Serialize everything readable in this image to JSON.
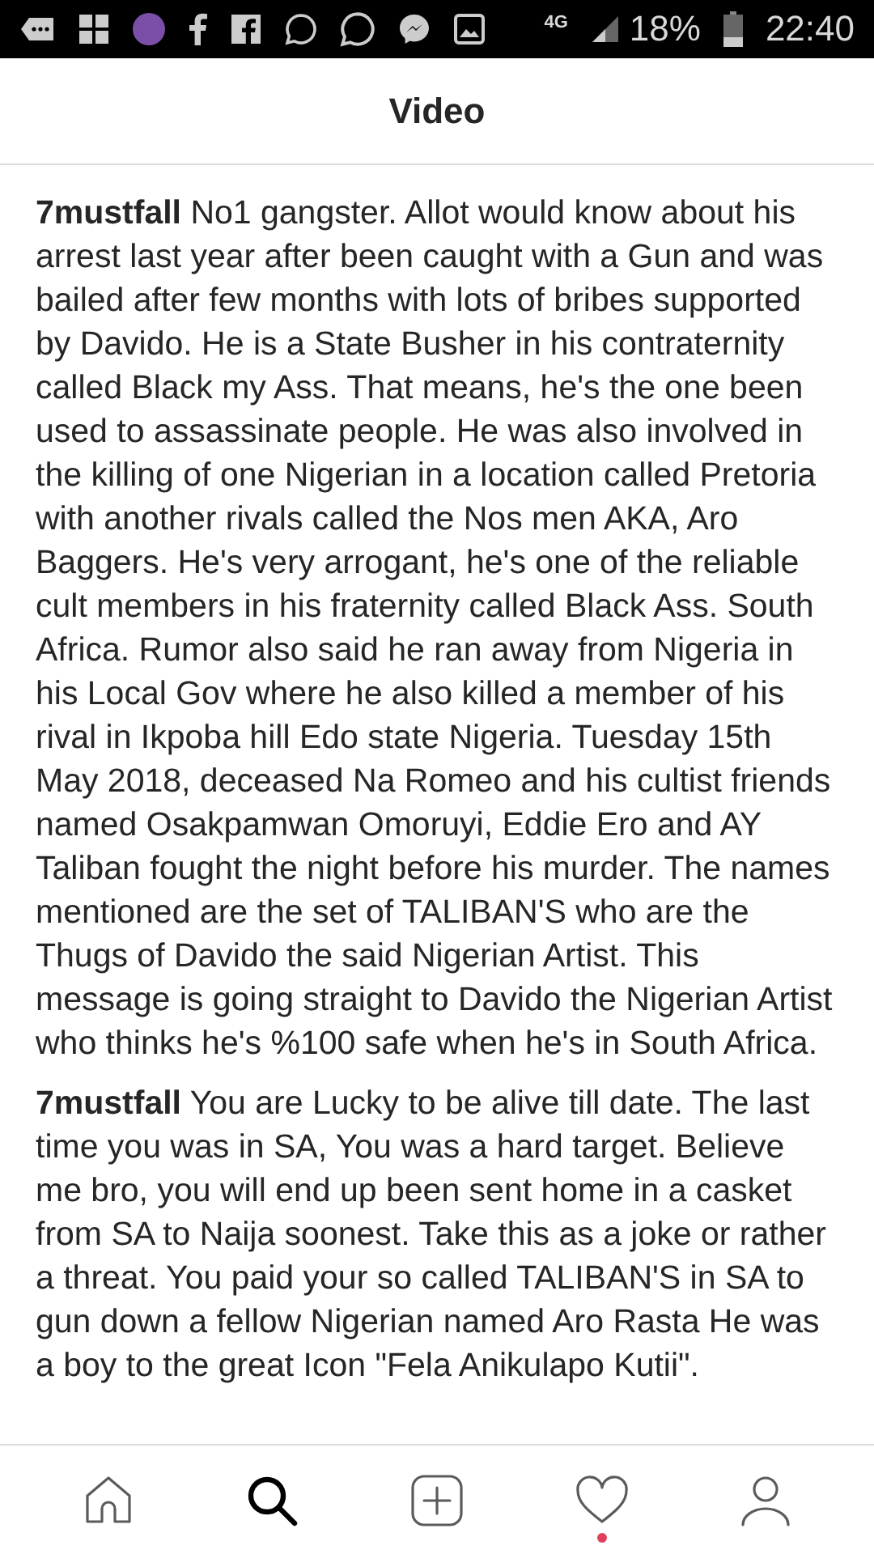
{
  "status_bar": {
    "network": "4G",
    "battery": "18%",
    "time": "22:40"
  },
  "header": {
    "title": "Video"
  },
  "comments": [
    {
      "username": "7mustfall",
      "text": "No1 gangster. Allot would know about his arrest last year after been caught with a Gun and was bailed after few months with lots of bribes supported by Davido. He is a State Busher in his contraternity called Black my Ass. That means, he's the one been used to assassinate people. He was also involved in the killing of one Nigerian in a location called Pretoria with another rivals called the Nos men AKA, Aro Baggers. He's very arrogant, he's one of the reliable cult members in his fraternity called Black Ass. South Africa. Rumor also said he ran away from Nigeria in his Local Gov where he also killed a member of his rival in Ikpoba hill Edo state Nigeria. Tuesday 15th May 2018, deceased Na Romeo and his cultist friends named Osakpamwan Omoruyi, Eddie Ero and AY Taliban fought the night before his murder. The names mentioned are the set of TALIBAN'S who are the Thugs of Davido the said Nigerian Artist. This message is going straight to Davido the Nigerian Artist who thinks he's %100 safe when he's in South Africa."
    },
    {
      "username": "7mustfall",
      "text": "You are Lucky to be alive till date. The last time you was in SA, You was a hard target. Believe me bro, you will end up been sent home in a casket from SA to Naija soonest. Take this as a joke or rather a threat. You paid your so called TALIBAN'S in SA to gun down a fellow Nigerian named Aro Rasta He was a boy to the great Icon \"Fela Anikulapo Kutii\"."
    }
  ],
  "nav": [
    {
      "kind": "home",
      "selected": false,
      "notification": false
    },
    {
      "kind": "search",
      "selected": true,
      "notification": false
    },
    {
      "kind": "add",
      "selected": false,
      "notification": false
    },
    {
      "kind": "heart",
      "selected": false,
      "notification": true
    },
    {
      "kind": "profile",
      "selected": false,
      "notification": false
    }
  ]
}
